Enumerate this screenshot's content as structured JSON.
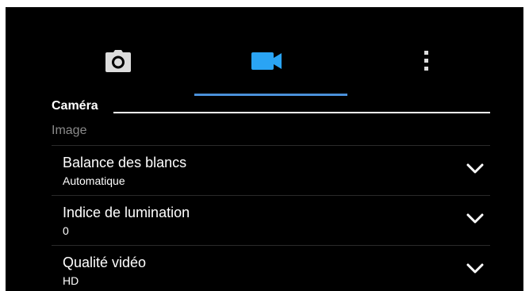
{
  "tabs": [
    {
      "name": "camera",
      "icon": "camera-icon",
      "active": false
    },
    {
      "name": "video",
      "icon": "video-camera-icon",
      "active": true
    },
    {
      "name": "more",
      "icon": "more-vertical-icon",
      "active": false
    }
  ],
  "colors": {
    "accent": "#4a90d9",
    "background": "#000000",
    "muted_text": "#8a8a8a"
  },
  "section": {
    "title": "Caméra",
    "subsection": "Image"
  },
  "settings": [
    {
      "title": "Balance des blancs",
      "value": "Automatique",
      "icon": "chevron-down-icon"
    },
    {
      "title": "Indice de lumination",
      "value": "0",
      "icon": "chevron-down-icon"
    },
    {
      "title": "Qualité vidéo",
      "value": "HD",
      "icon": "chevron-down-icon"
    }
  ]
}
